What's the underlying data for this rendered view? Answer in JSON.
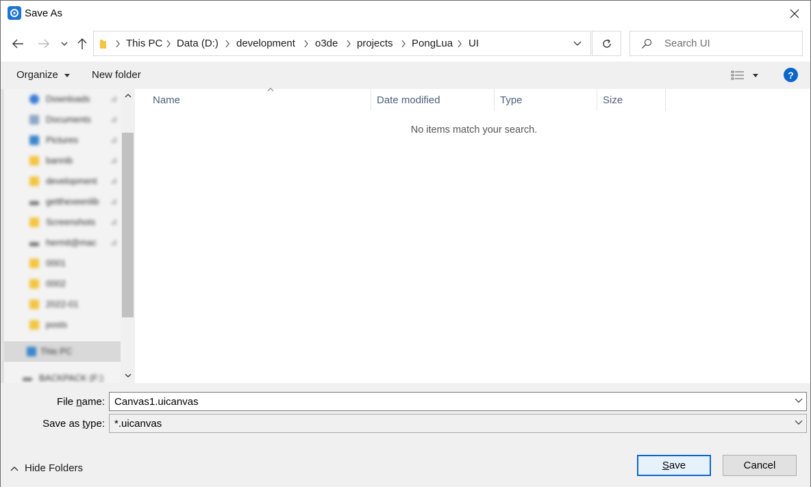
{
  "window": {
    "title": "Save As",
    "accent_color": "#0a66c8"
  },
  "address": {
    "breadcrumbs": [
      {
        "label": "This PC"
      },
      {
        "label": "Data (D:)"
      },
      {
        "label": "development"
      },
      {
        "label": "o3de"
      },
      {
        "label": "projects"
      },
      {
        "label": "PongLua"
      },
      {
        "label": "UI"
      }
    ]
  },
  "search": {
    "placeholder": "Search UI"
  },
  "toolbar": {
    "organize_label": "Organize",
    "new_folder_label": "New folder",
    "help_label": "?"
  },
  "navpane": {
    "items": [
      {
        "label": "Downloads",
        "icon": "download-icon",
        "color": "#3a7bd5",
        "pinned": true
      },
      {
        "label": "Documents",
        "icon": "document-icon",
        "color": "#8ea7c4",
        "pinned": true
      },
      {
        "label": "Pictures",
        "icon": "picture-icon",
        "color": "#3c86cc",
        "pinned": true
      },
      {
        "label": "bannib",
        "icon": "folder-icon",
        "color": "#f4c542",
        "pinned": true
      },
      {
        "label": "development",
        "icon": "folder-icon",
        "color": "#f4c542",
        "pinned": true
      },
      {
        "label": "getthexeenlib",
        "icon": "drive-icon",
        "color": "#777777",
        "pinned": true
      },
      {
        "label": "Screenshots",
        "icon": "folder-icon",
        "color": "#f4c542",
        "pinned": true
      },
      {
        "label": "hermit@mac",
        "icon": "drive-icon",
        "color": "#777777",
        "pinned": true
      },
      {
        "label": "0001",
        "icon": "folder-icon",
        "color": "#f4c542",
        "pinned": false
      },
      {
        "label": "0002",
        "icon": "folder-icon",
        "color": "#f4c542",
        "pinned": false
      },
      {
        "label": "2022-01",
        "icon": "folder-icon",
        "color": "#f4c542",
        "pinned": false
      },
      {
        "label": "posts",
        "icon": "folder-icon",
        "color": "#f4c542",
        "pinned": false
      },
      {
        "label": "This PC",
        "icon": "computer-icon",
        "color": "#3c86cc",
        "pinned": false
      },
      {
        "label": "BACKPACK (F:)",
        "icon": "drive-icon",
        "color": "#777777",
        "pinned": false
      }
    ]
  },
  "filelist": {
    "columns": [
      {
        "label": "Name"
      },
      {
        "label": "Date modified"
      },
      {
        "label": "Type"
      },
      {
        "label": "Size"
      }
    ],
    "empty_message": "No items match your search."
  },
  "form": {
    "file_name_label_pre": "File ",
    "file_name_label_ul": "n",
    "file_name_label_post": "ame:",
    "file_name_value": "Canvas1.uicanvas",
    "save_type_label_pre": "Save as ",
    "save_type_label_ul": "t",
    "save_type_label_post": "ype:",
    "save_type_value": "*.uicanvas"
  },
  "footer": {
    "hide_folders_label": "Hide Folders",
    "save_label_ul": "S",
    "save_label_post": "ave",
    "cancel_label": "Cancel"
  }
}
